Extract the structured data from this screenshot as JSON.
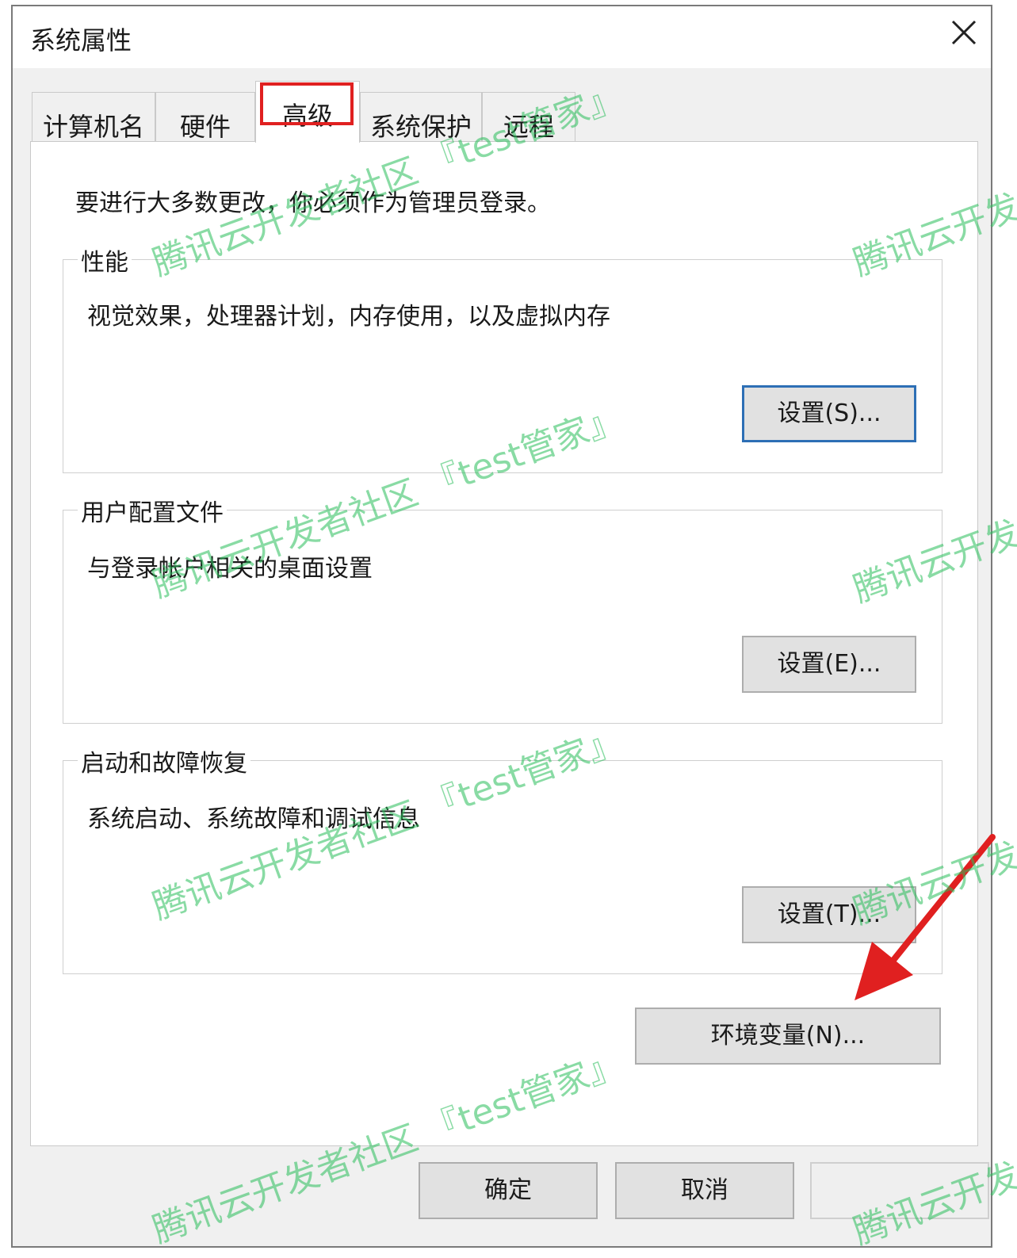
{
  "window": {
    "title": "系统属性",
    "close_icon": "close-icon"
  },
  "tabs": [
    {
      "label": "计算机名",
      "active": false
    },
    {
      "label": "硬件",
      "active": false
    },
    {
      "label": "高级",
      "active": true
    },
    {
      "label": "系统保护",
      "active": false
    },
    {
      "label": "远程",
      "active": false
    }
  ],
  "advanced": {
    "admin_note": "要进行大多数更改，你必须作为管理员登录。",
    "performance": {
      "title": "性能",
      "description": "视觉效果，处理器计划，内存使用，以及虚拟内存",
      "button": "设置(S)..."
    },
    "user_profiles": {
      "title": "用户配置文件",
      "description": "与登录帐户相关的桌面设置",
      "button": "设置(E)..."
    },
    "startup_recovery": {
      "title": "启动和故障恢复",
      "description": "系统启动、系统故障和调试信息",
      "button": "设置(T)..."
    },
    "env_button": "环境变量(N)..."
  },
  "footer": {
    "ok": "确定",
    "cancel": "取消"
  },
  "watermarks": [
    "腾讯云开发者社区 『test管家』",
    "腾讯云开发"
  ],
  "colors": {
    "highlight_box": "#e02020",
    "arrow": "#e02020",
    "focus_border": "#2d6fb5",
    "watermark": "#28be5a"
  }
}
